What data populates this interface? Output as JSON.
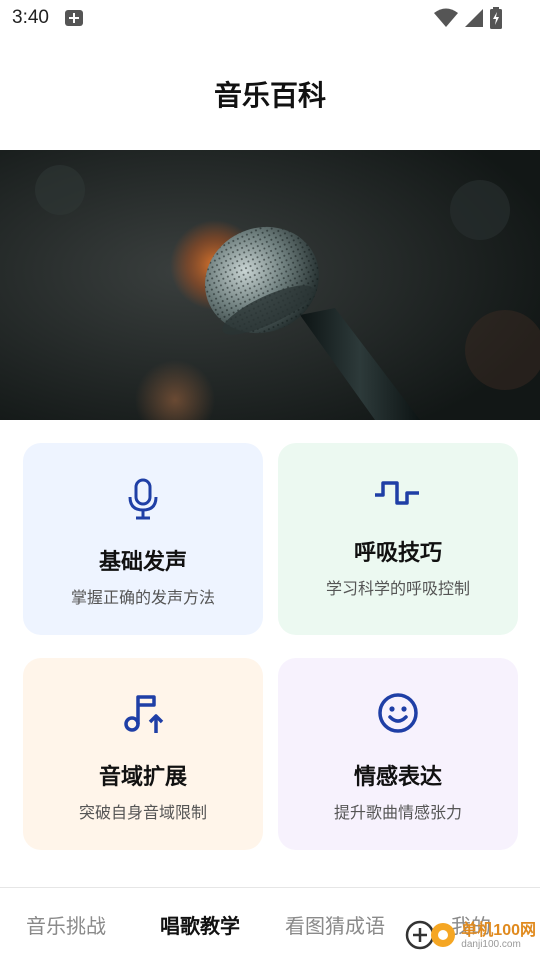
{
  "status_bar": {
    "time": "3:40",
    "icons": [
      "notification-plus-icon",
      "wifi-icon",
      "signal-icon",
      "battery-charging-icon"
    ]
  },
  "header": {
    "title": "音乐百科"
  },
  "hero": {
    "image": "microphone-photo"
  },
  "cards": [
    {
      "title": "基础发声",
      "subtitle": "掌握正确的发声方法",
      "icon": "microphone-icon",
      "bg": "#eef4ff"
    },
    {
      "title": "呼吸技巧",
      "subtitle": "学习科学的呼吸控制",
      "icon": "wave-icon",
      "bg": "#ecf9f1"
    },
    {
      "title": "音域扩展",
      "subtitle": "突破自身音域限制",
      "icon": "music-note-icon",
      "bg": "#fff5ea"
    },
    {
      "title": "情感表达",
      "subtitle": "提升歌曲情感张力",
      "icon": "smile-icon",
      "bg": "#f7f2fd"
    }
  ],
  "bottom_nav": {
    "tabs": [
      {
        "label": "音乐挑战",
        "active": false
      },
      {
        "label": "唱歌教学",
        "active": true
      },
      {
        "label": "看图猜成语",
        "active": false
      },
      {
        "label": "我的",
        "active": false
      }
    ]
  },
  "watermark": {
    "line1": "单机100网",
    "line2": "danji100.com"
  },
  "colors": {
    "icon_blue": "#1f3fa6",
    "text_primary": "#111111",
    "text_secondary": "#555555",
    "tab_inactive": "#8a8a8a"
  }
}
